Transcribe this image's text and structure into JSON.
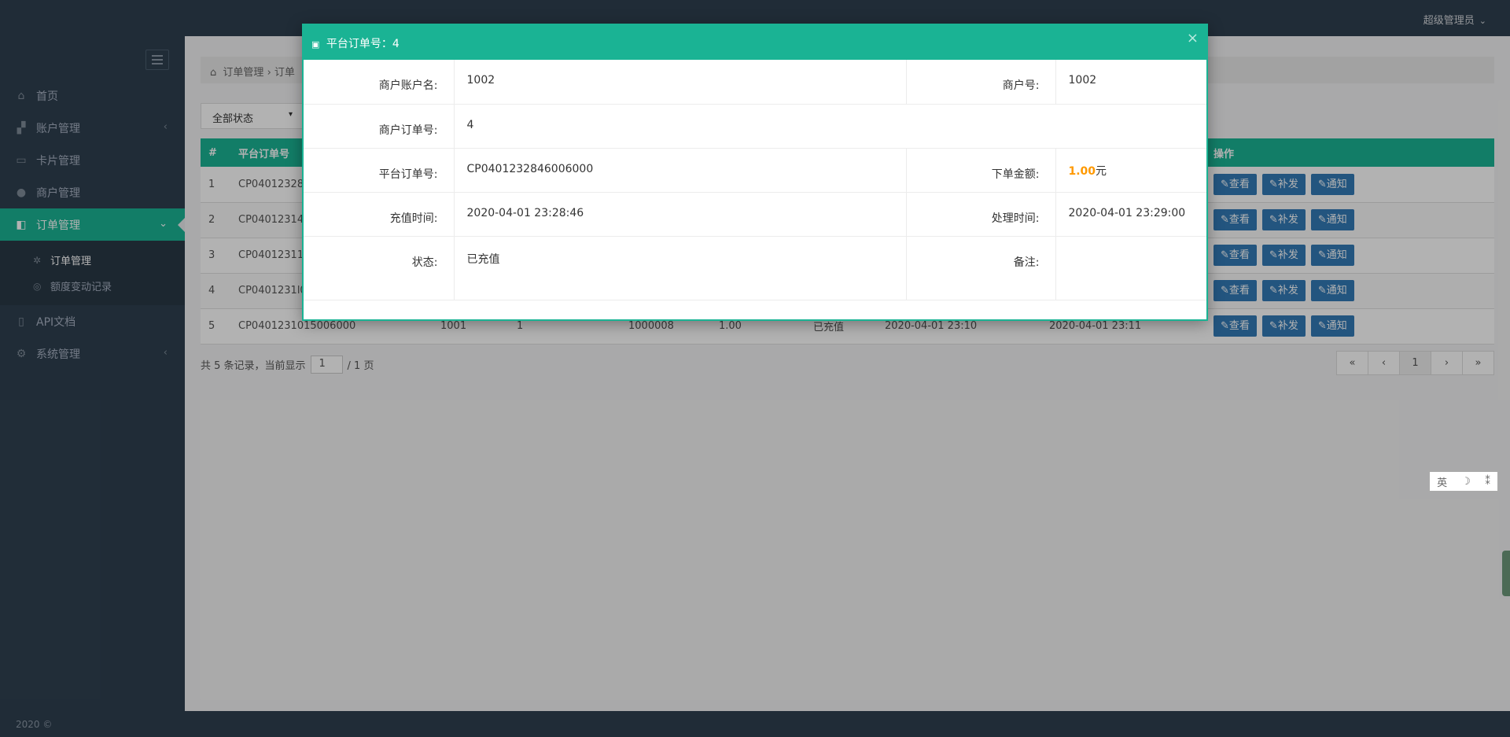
{
  "topbar": {
    "user": "超级管理员",
    "caret": "⌄"
  },
  "sidebar": {
    "items": [
      {
        "label": "首页",
        "icon": "home-icon",
        "glyph": "⌂"
      },
      {
        "label": "账户管理",
        "icon": "cubes-icon",
        "glyph": "▞",
        "arrow": "‹"
      },
      {
        "label": "卡片管理",
        "icon": "credit-card-icon",
        "glyph": "▭"
      },
      {
        "label": "商户管理",
        "icon": "user-icon",
        "glyph": "●"
      },
      {
        "label": "订单管理",
        "icon": "dashboard-icon",
        "glyph": "◧",
        "arrow": "⌄"
      },
      {
        "label": "API文档",
        "icon": "book-icon",
        "glyph": "▯"
      },
      {
        "label": "系统管理",
        "icon": "gear-icon",
        "glyph": "⚙",
        "arrow": "‹"
      }
    ],
    "sub": [
      {
        "label": "订单管理",
        "icon": "cubes-icon",
        "glyph": "✲"
      },
      {
        "label": "额度变动记录",
        "icon": "dribbble-icon",
        "glyph": "◎"
      }
    ]
  },
  "breadcrumb": {
    "home": "订单管理",
    "sep": "›",
    "current": "订单"
  },
  "filter": {
    "status": "全部状态",
    "caret": "▾"
  },
  "table": {
    "headers": [
      "#",
      "平台订单号",
      "",
      "",
      "",
      "",
      "",
      "",
      "",
      "操作"
    ],
    "rows": [
      [
        "1",
        "CP04012328",
        "",
        "",
        "",
        "",
        "",
        "",
        ""
      ],
      [
        "2",
        "CP04012314",
        "",
        "",
        "",
        "",
        "",
        "",
        ""
      ],
      [
        "3",
        "CP04012311",
        "",
        "",
        "",
        "",
        "",
        "",
        ""
      ],
      [
        "4",
        "CP0401231l0",
        "",
        "",
        "",
        "",
        "",
        "",
        ""
      ],
      [
        "5",
        "CP0401231015006000",
        "1001",
        "1",
        "1000008",
        "1.00",
        "已充值",
        "2020-04-01 23:10",
        "2020-04-01 23:11"
      ]
    ],
    "ops": [
      "查看",
      "补发",
      "通知"
    ],
    "op_icon": "✎"
  },
  "pager": {
    "prefix": "共 5 条记录，当前显示",
    "page": "1",
    "suffix": "/ 1 页",
    "buttons": [
      "«",
      "‹",
      "1",
      "›",
      "»"
    ]
  },
  "footer": {
    "text": "2020 ©"
  },
  "modal": {
    "title": "平台订单号：4",
    "gift_icon": "🎁",
    "close": "×",
    "merchant_account_label": "商户账户名:",
    "merchant_account": "1002",
    "merchant_no_label": "商户号:",
    "merchant_no": "1002",
    "merchant_order_label": "商户订单号:",
    "merchant_order": "4",
    "platform_order_label": "平台订单号:",
    "platform_order": "CP0401232846006000",
    "amount_label": "下单金额:",
    "amount": "1.00",
    "amount_unit": "元",
    "recharge_time_label": "充值时间:",
    "recharge_time": "2020-04-01 23:28:46",
    "process_time_label": "处理时间:",
    "process_time": "2020-04-01 23:29:00",
    "status_label": "状态:",
    "status": "已充值",
    "remark_label": "备注:",
    "remark": ""
  },
  "ime": {
    "lang": "英",
    "moon": "☽",
    "punct": "⁑"
  },
  "colors": {
    "accent": "#1ab394",
    "sidebar": "#2f4050",
    "button": "#337ab7",
    "green": "#1aad19",
    "red": "#ff0000",
    "orange": "#ff9900"
  }
}
